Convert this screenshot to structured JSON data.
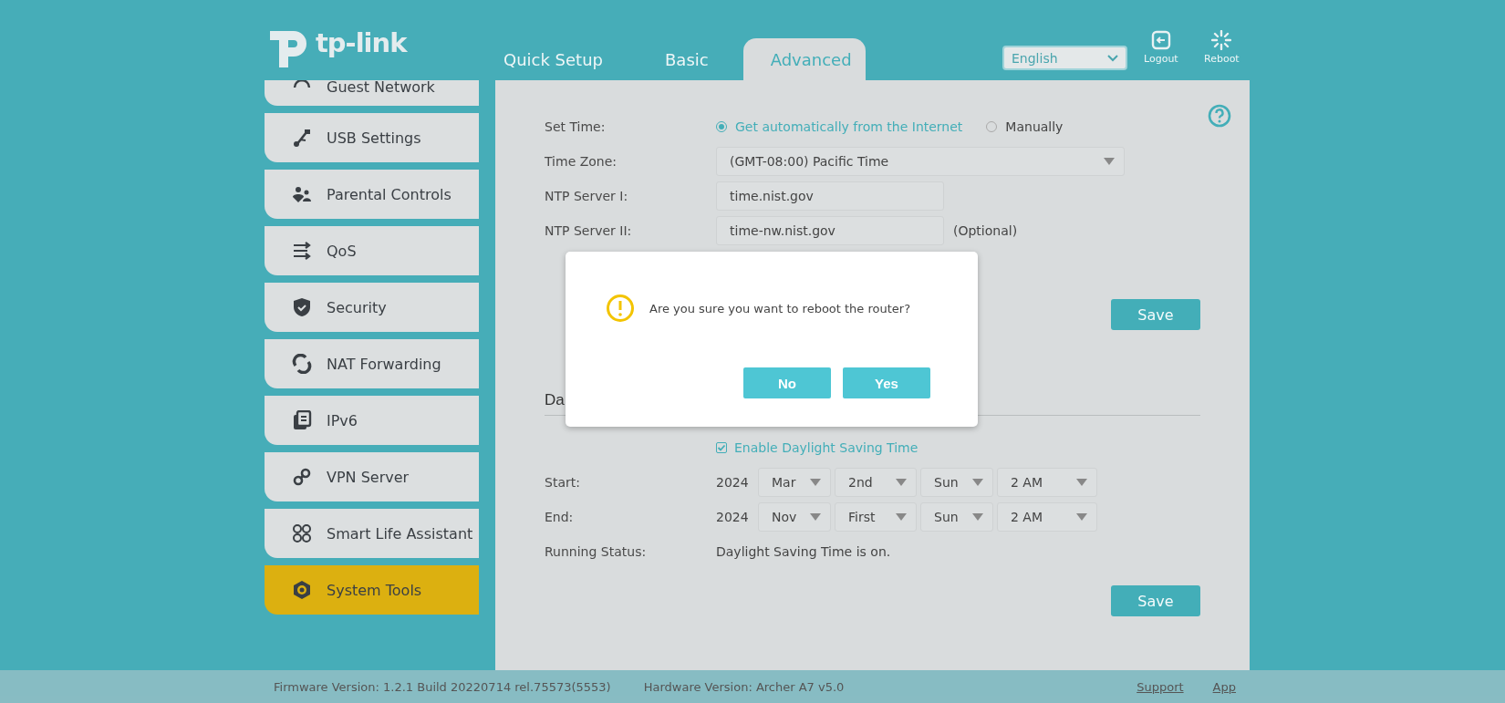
{
  "header": {
    "logo": "tp-link",
    "tabs": [
      {
        "label": "Quick Setup",
        "selected": false
      },
      {
        "label": "Basic",
        "selected": false
      },
      {
        "label": "Advanced",
        "selected": true
      }
    ],
    "language": "English",
    "logout": "Logout",
    "reboot": "Reboot"
  },
  "sidebar": {
    "items": [
      {
        "label": "Guest Network",
        "selected": false
      },
      {
        "label": "USB Settings",
        "selected": false
      },
      {
        "label": "Parental Controls",
        "selected": false
      },
      {
        "label": "QoS",
        "selected": false
      },
      {
        "label": "Security",
        "selected": false
      },
      {
        "label": "NAT Forwarding",
        "selected": false
      },
      {
        "label": "IPv6",
        "selected": false
      },
      {
        "label": "VPN Server",
        "selected": false
      },
      {
        "label": "Smart Life Assistant",
        "selected": false
      },
      {
        "label": "System Tools",
        "selected": true
      }
    ]
  },
  "time_settings": {
    "set_time_label": "Set Time:",
    "set_time_options": [
      {
        "label": "Get automatically from the Internet",
        "selected": true
      },
      {
        "label": "Manually",
        "selected": false
      }
    ],
    "time_zone_label": "Time Zone:",
    "time_zone": "(GMT-08:00) Pacific Time",
    "ntp1_label": "NTP Server I:",
    "ntp1": "time.nist.gov",
    "ntp2_label": "NTP Server II:",
    "ntp2": "time-nw.nist.gov",
    "ntp2_note": "(Optional)",
    "save": "Save"
  },
  "dst": {
    "heading": "Da",
    "enable_label": "Enable Daylight Saving Time",
    "enabled": true,
    "rows": [
      {
        "label": "Start:",
        "year": "2024",
        "fields": [
          "Mar",
          "2nd",
          "Sun",
          "2 AM"
        ]
      },
      {
        "label": "End:",
        "year": "2024",
        "fields": [
          "Nov",
          "First",
          "Sun",
          "2 AM"
        ]
      }
    ],
    "status_label": "Running Status:",
    "status": "Daylight Saving Time is on.",
    "save": "Save"
  },
  "dialog": {
    "message": "Are you sure you want to reboot the router?",
    "buttons": [
      "No",
      "Yes"
    ]
  },
  "footer": {
    "firmware": "Firmware Version: 1.2.1 Build 20220714 rel.75573(5553)",
    "hardware": "Hardware Version: Archer A7 v5.0",
    "links": [
      "Support",
      "App"
    ]
  }
}
